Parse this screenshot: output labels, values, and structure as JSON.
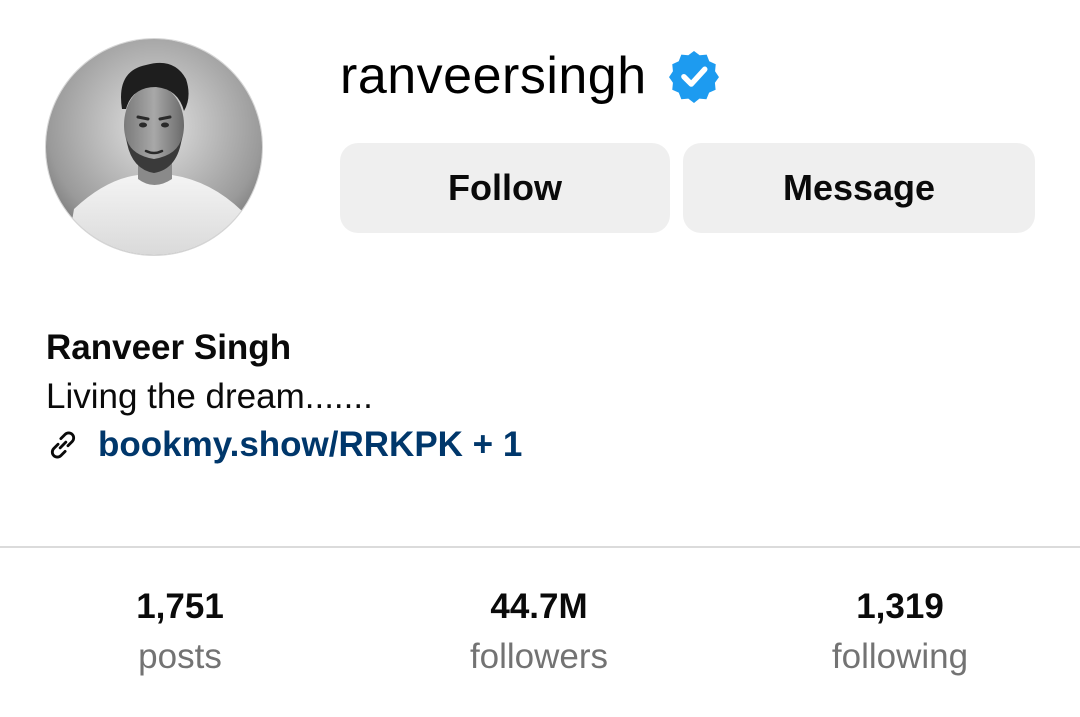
{
  "profile": {
    "username": "ranveersingh",
    "verified_icon": "verified-badge-icon",
    "avatar_icon": "profile-photo",
    "full_name": "Ranveer Singh",
    "bio": "Living the dream.......",
    "link_icon": "link-icon",
    "link_text": "bookmy.show/RRKPK + 1"
  },
  "actions": {
    "follow_label": "Follow",
    "message_label": "Message"
  },
  "stats": [
    {
      "value": "1,751",
      "label": "posts"
    },
    {
      "value": "44.7M",
      "label": "followers"
    },
    {
      "value": "1,319",
      "label": "following"
    }
  ],
  "colors": {
    "verified": "#1d9bf0",
    "link": "#00376b",
    "button_bg": "#efefef",
    "muted_text": "#737373",
    "divider": "#dbdbdb"
  }
}
